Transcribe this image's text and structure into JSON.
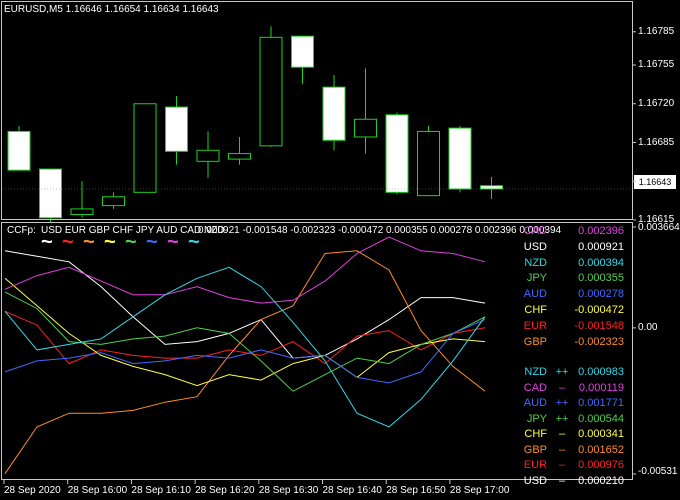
{
  "main_chart": {
    "title": "EURUSD,M5  1.16646 1.16654 1.16634 1.16643",
    "current_price": "1.16643",
    "price_axis": [
      "1.16785",
      "1.16755",
      "1.16720",
      "1.16685",
      "1.16650",
      "1.16615"
    ],
    "candles": [
      {
        "o": 1.16695,
        "h": 1.167,
        "l": 1.1666,
        "c": 1.1666
      },
      {
        "o": 1.16661,
        "h": 1.16661,
        "l": 1.16613,
        "c": 1.16617
      },
      {
        "o": 1.1662,
        "h": 1.1665,
        "l": 1.16617,
        "c": 1.16625
      },
      {
        "o": 1.16628,
        "h": 1.1664,
        "l": 1.16625,
        "c": 1.16636
      },
      {
        "o": 1.1664,
        "h": 1.1672,
        "l": 1.1664,
        "c": 1.1672
      },
      {
        "o": 1.16717,
        "h": 1.16727,
        "l": 1.16665,
        "c": 1.16677
      },
      {
        "o": 1.16668,
        "h": 1.16695,
        "l": 1.16653,
        "c": 1.16678
      },
      {
        "o": 1.1667,
        "h": 1.1669,
        "l": 1.16665,
        "c": 1.16675
      },
      {
        "o": 1.16682,
        "h": 1.1679,
        "l": 1.16681,
        "c": 1.1678
      },
      {
        "o": 1.16781,
        "h": 1.16781,
        "l": 1.16738,
        "c": 1.16753
      },
      {
        "o": 1.16735,
        "h": 1.16746,
        "l": 1.16678,
        "c": 1.16687
      },
      {
        "o": 1.1669,
        "h": 1.16752,
        "l": 1.16675,
        "c": 1.16706
      },
      {
        "o": 1.1671,
        "h": 1.16712,
        "l": 1.16638,
        "c": 1.1664
      },
      {
        "o": 1.16637,
        "h": 1.167,
        "l": 1.16637,
        "c": 1.16695
      },
      {
        "o": 1.16698,
        "h": 1.167,
        "l": 1.1664,
        "c": 1.16643
      },
      {
        "o": 1.16646,
        "h": 1.16654,
        "l": 1.16634,
        "c": 1.16643
      }
    ]
  },
  "indicator": {
    "header_prefix": "CCFp:",
    "header_currencies": "USD EUR GBP CHF JPY AUD CAD NZD",
    "header_values": "0.000921 -0.001548 -0.002323 -0.000472 0.000355 0.000278 0.002396 0.000394",
    "axis_top": "0.003664",
    "axis_mid": "0.00",
    "axis_bottom": "-0.00531",
    "colors": {
      "USD": "#ffffff",
      "EUR": "#ff2020",
      "GBP": "#ff8c2a",
      "CHF": "#ffff40",
      "JPY": "#50d050",
      "AUD": "#4169ff",
      "CAD": "#e040e0",
      "NZD": "#30d8e8"
    },
    "wave_colors": [
      "#ffffff",
      "#ff2020",
      "#ff8c2a",
      "#ffff40",
      "#50d050",
      "#4169ff",
      "#e040e0",
      "#30d8e8"
    ],
    "wave_glyph": "~",
    "strength_list": [
      {
        "cur": "CAD",
        "value": "0.002396",
        "color": "#e040e0"
      },
      {
        "cur": "USD",
        "value": "0.000921",
        "color": "#ffffff"
      },
      {
        "cur": "NZD",
        "value": "0.000394",
        "color": "#30d8e8"
      },
      {
        "cur": "JPY",
        "value": "0.000355",
        "color": "#50d050"
      },
      {
        "cur": "AUD",
        "value": "0.000278",
        "color": "#4169ff"
      },
      {
        "cur": "CHF",
        "value": "-0.000472",
        "color": "#ffff40"
      },
      {
        "cur": "EUR",
        "value": "-0.001548",
        "color": "#ff2020"
      },
      {
        "cur": "GBP",
        "value": "-0.002323",
        "color": "#ff8c2a"
      }
    ],
    "change_list": [
      {
        "cur": "NZD",
        "arrow": "++",
        "value": "0.000983",
        "color": "#30d8e8"
      },
      {
        "cur": "CAD",
        "arrow": "–",
        "value": "0.000119",
        "color": "#e040e0"
      },
      {
        "cur": "AUD",
        "arrow": "++",
        "value": "0.001771",
        "color": "#4169ff"
      },
      {
        "cur": "JPY",
        "arrow": "++",
        "value": "0.000544",
        "color": "#50d050"
      },
      {
        "cur": "CHF",
        "arrow": "–",
        "value": "0.000341",
        "color": "#ffff40"
      },
      {
        "cur": "GBP",
        "arrow": "–",
        "value": "0.001652",
        "color": "#ff8c2a"
      },
      {
        "cur": "EUR",
        "arrow": "–",
        "value": "0.000976",
        "color": "#ff2020"
      },
      {
        "cur": "USD",
        "arrow": "–",
        "value": "0.000210",
        "color": "#ffffff"
      }
    ],
    "series": [
      {
        "cur": "USD",
        "values": [
          0.0028,
          0.0026,
          0.0024,
          0.0015,
          0.0004,
          -0.0006,
          -0.0005,
          -0.0002,
          0.0003,
          -0.0011,
          -0.001,
          -0.0004,
          0.0003,
          0.0011,
          0.0011,
          0.0009
        ]
      },
      {
        "cur": "EUR",
        "values": [
          0.0006,
          0.0001,
          -0.0013,
          -0.0008,
          -0.001,
          -0.0011,
          -0.0011,
          -0.0008,
          -0.001,
          -0.0005,
          -0.0013,
          -0.0003,
          -0.0001,
          -0.0008,
          -0.0002,
          0.0
        ]
      },
      {
        "cur": "GBP",
        "values": [
          -0.0053,
          -0.0036,
          -0.0031,
          -0.0031,
          -0.003,
          -0.0027,
          -0.0025,
          -0.001,
          0.0003,
          0.0008,
          0.0027,
          0.0028,
          0.0021,
          -0.0001,
          -0.0014,
          -0.0023
        ]
      },
      {
        "cur": "CHF",
        "values": [
          0.0018,
          0.0008,
          -0.0002,
          -0.001,
          -0.0014,
          -0.0017,
          -0.0021,
          -0.0017,
          -0.0019,
          -0.0013,
          -0.001,
          -0.0018,
          -0.0009,
          -0.0006,
          -0.0004,
          -0.0005
        ]
      },
      {
        "cur": "JPY",
        "values": [
          0.0013,
          0.0007,
          -0.0005,
          -0.0006,
          -0.0004,
          -0.0003,
          0.0,
          -0.0002,
          -0.0012,
          -0.0023,
          -0.0017,
          -0.0011,
          -0.0013,
          -0.0006,
          -0.0002,
          0.0004
        ]
      },
      {
        "cur": "AUD",
        "values": [
          -0.0016,
          -0.0012,
          -0.0011,
          -0.0009,
          -0.0013,
          -0.0012,
          -0.001,
          -0.0011,
          -0.0008,
          -0.0011,
          -0.001,
          -0.0018,
          -0.002,
          -0.0016,
          -0.0002,
          0.0003
        ]
      },
      {
        "cur": "CAD",
        "values": [
          0.0014,
          0.0019,
          0.0022,
          0.0017,
          0.0012,
          0.0012,
          0.0015,
          0.0011,
          0.0009,
          0.001,
          0.0017,
          0.0027,
          0.0033,
          0.0028,
          0.0027,
          0.0024
        ]
      },
      {
        "cur": "NZD",
        "values": [
          0.0006,
          -0.0008,
          -0.0006,
          -0.0004,
          0.0004,
          0.0012,
          0.0018,
          0.0022,
          0.0015,
          0.0002,
          -0.0012,
          -0.0031,
          -0.0036,
          -0.0026,
          -0.0012,
          0.0004
        ]
      }
    ],
    "time_axis": [
      "28 Sep 2020",
      "28 Sep 16:00",
      "28 Sep 16:10",
      "28 Sep 16:20",
      "28 Sep 16:30",
      "28 Sep 16:40",
      "28 Sep 16:50",
      "28 Sep 17:00"
    ]
  }
}
